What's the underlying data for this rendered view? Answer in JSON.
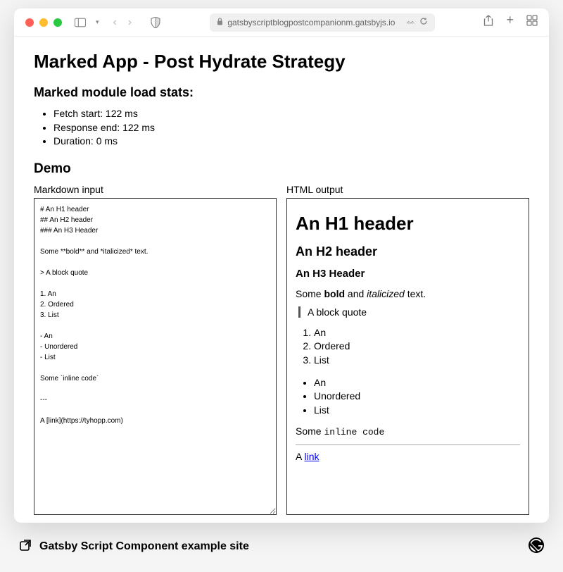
{
  "browser": {
    "url": "gatsbyscriptblogpostcompanionm.gatsbyjs.io"
  },
  "page": {
    "title": "Marked App - Post Hydrate Strategy",
    "stats_heading": "Marked module load stats:",
    "stats": {
      "fetch_start": "Fetch start: 122 ms",
      "response_end": "Response end: 122 ms",
      "duration": "Duration: 0 ms"
    },
    "demo_heading": "Demo",
    "columns": {
      "input_label": "Markdown input",
      "output_label": "HTML output"
    },
    "markdown_source": "# An H1 header\n## An H2 header\n### An H3 Header\n\nSome **bold** and *italicized* text.\n\n> A block quote\n\n1. An\n2. Ordered\n3. List\n\n- An\n- Unordered\n- List\n\nSome `inline code`\n\n---\n\nA [link](https://tyhopp.com)",
    "output": {
      "h1": "An H1 header",
      "h2": "An H2 header",
      "h3": "An H3 Header",
      "para_prefix": "Some ",
      "bold": "bold",
      "and": " and ",
      "italic": "italicized",
      "para_suffix": " text.",
      "blockquote": "A block quote",
      "ol": [
        "An",
        "Ordered",
        "List"
      ],
      "ul": [
        "An",
        "Unordered",
        "List"
      ],
      "code_prefix": "Some ",
      "code": "inline code",
      "link_prefix": "A ",
      "link_text": "link"
    }
  },
  "footer": {
    "caption": "Gatsby Script Component example site"
  }
}
